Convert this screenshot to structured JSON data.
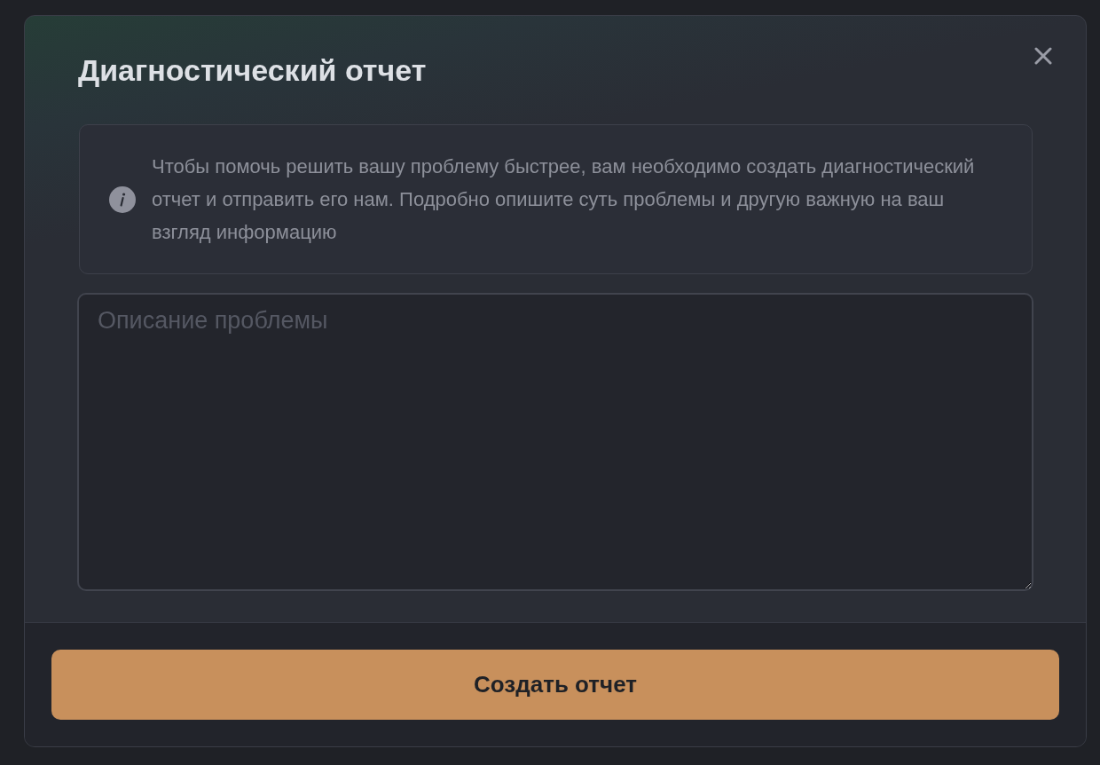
{
  "dialog": {
    "title": "Диагностический отчет"
  },
  "info": {
    "text": "Чтобы помочь решить вашу проблему быстрее, вам необходимо создать диагностический отчет и отправить его нам. Подробно опишите суть проблемы и другую важную на ваш взгляд информацию"
  },
  "description_field": {
    "placeholder": "Описание проблемы"
  },
  "submit_button": {
    "label": "Создать отчет"
  }
}
